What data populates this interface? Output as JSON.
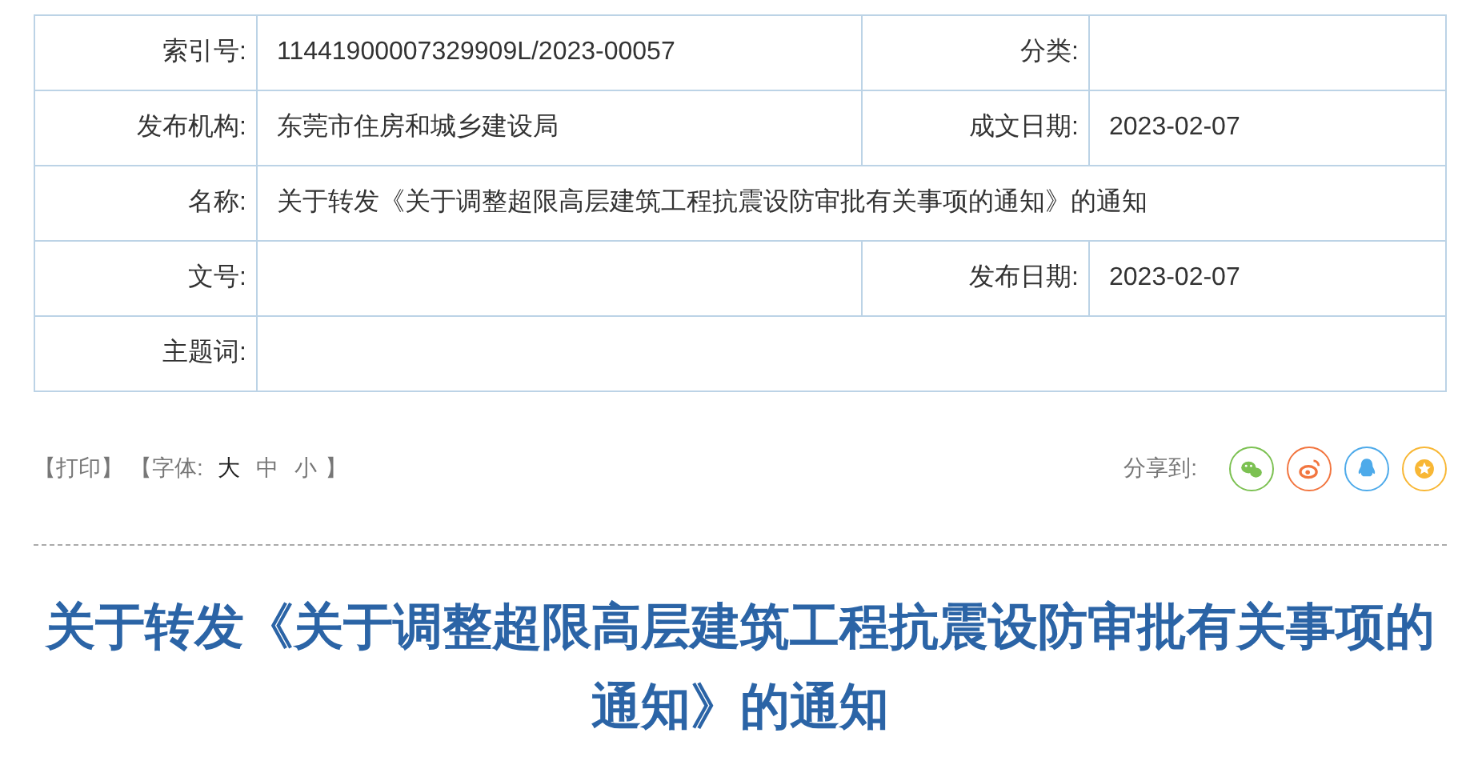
{
  "info_table": {
    "rows": [
      {
        "fields": [
          {
            "label": "索引号:",
            "value": "11441900007329909L/2023-00057"
          },
          {
            "label": "分类:"
          }
        ]
      },
      {
        "fields": [
          {
            "label": "发布机构:",
            "value": "东莞市住房和城乡建设局"
          },
          {
            "label": "成文日期:",
            "value": "2023-02-07"
          }
        ]
      },
      {
        "fields": [
          {
            "label": "名称:",
            "value": "关于转发《关于调整超限高层建筑工程抗震设防审批有关事项的通知》的通知"
          }
        ]
      },
      {
        "fields": [
          {
            "label": "文号:"
          },
          {
            "label": "发布日期:",
            "value": "2023-02-07"
          }
        ]
      },
      {
        "fields": [
          {
            "label": "主题词:"
          }
        ]
      }
    ]
  },
  "toolbar": {
    "print": "【打印】",
    "font_label": "【字体:",
    "font_sizes": [
      {
        "label": "大",
        "selected": true
      },
      {
        "label": "中",
        "selected": false
      },
      {
        "label": "小",
        "selected": false
      }
    ],
    "font_end": "】",
    "share_label": "分享到:",
    "share_targets": [
      {
        "kind": "wechat"
      },
      {
        "kind": "weibo"
      },
      {
        "kind": "qq"
      },
      {
        "kind": "favorite"
      }
    ]
  },
  "title": "关于转发《关于调整超限高层建筑工程抗震设防审批有关事项的通知》的通知"
}
